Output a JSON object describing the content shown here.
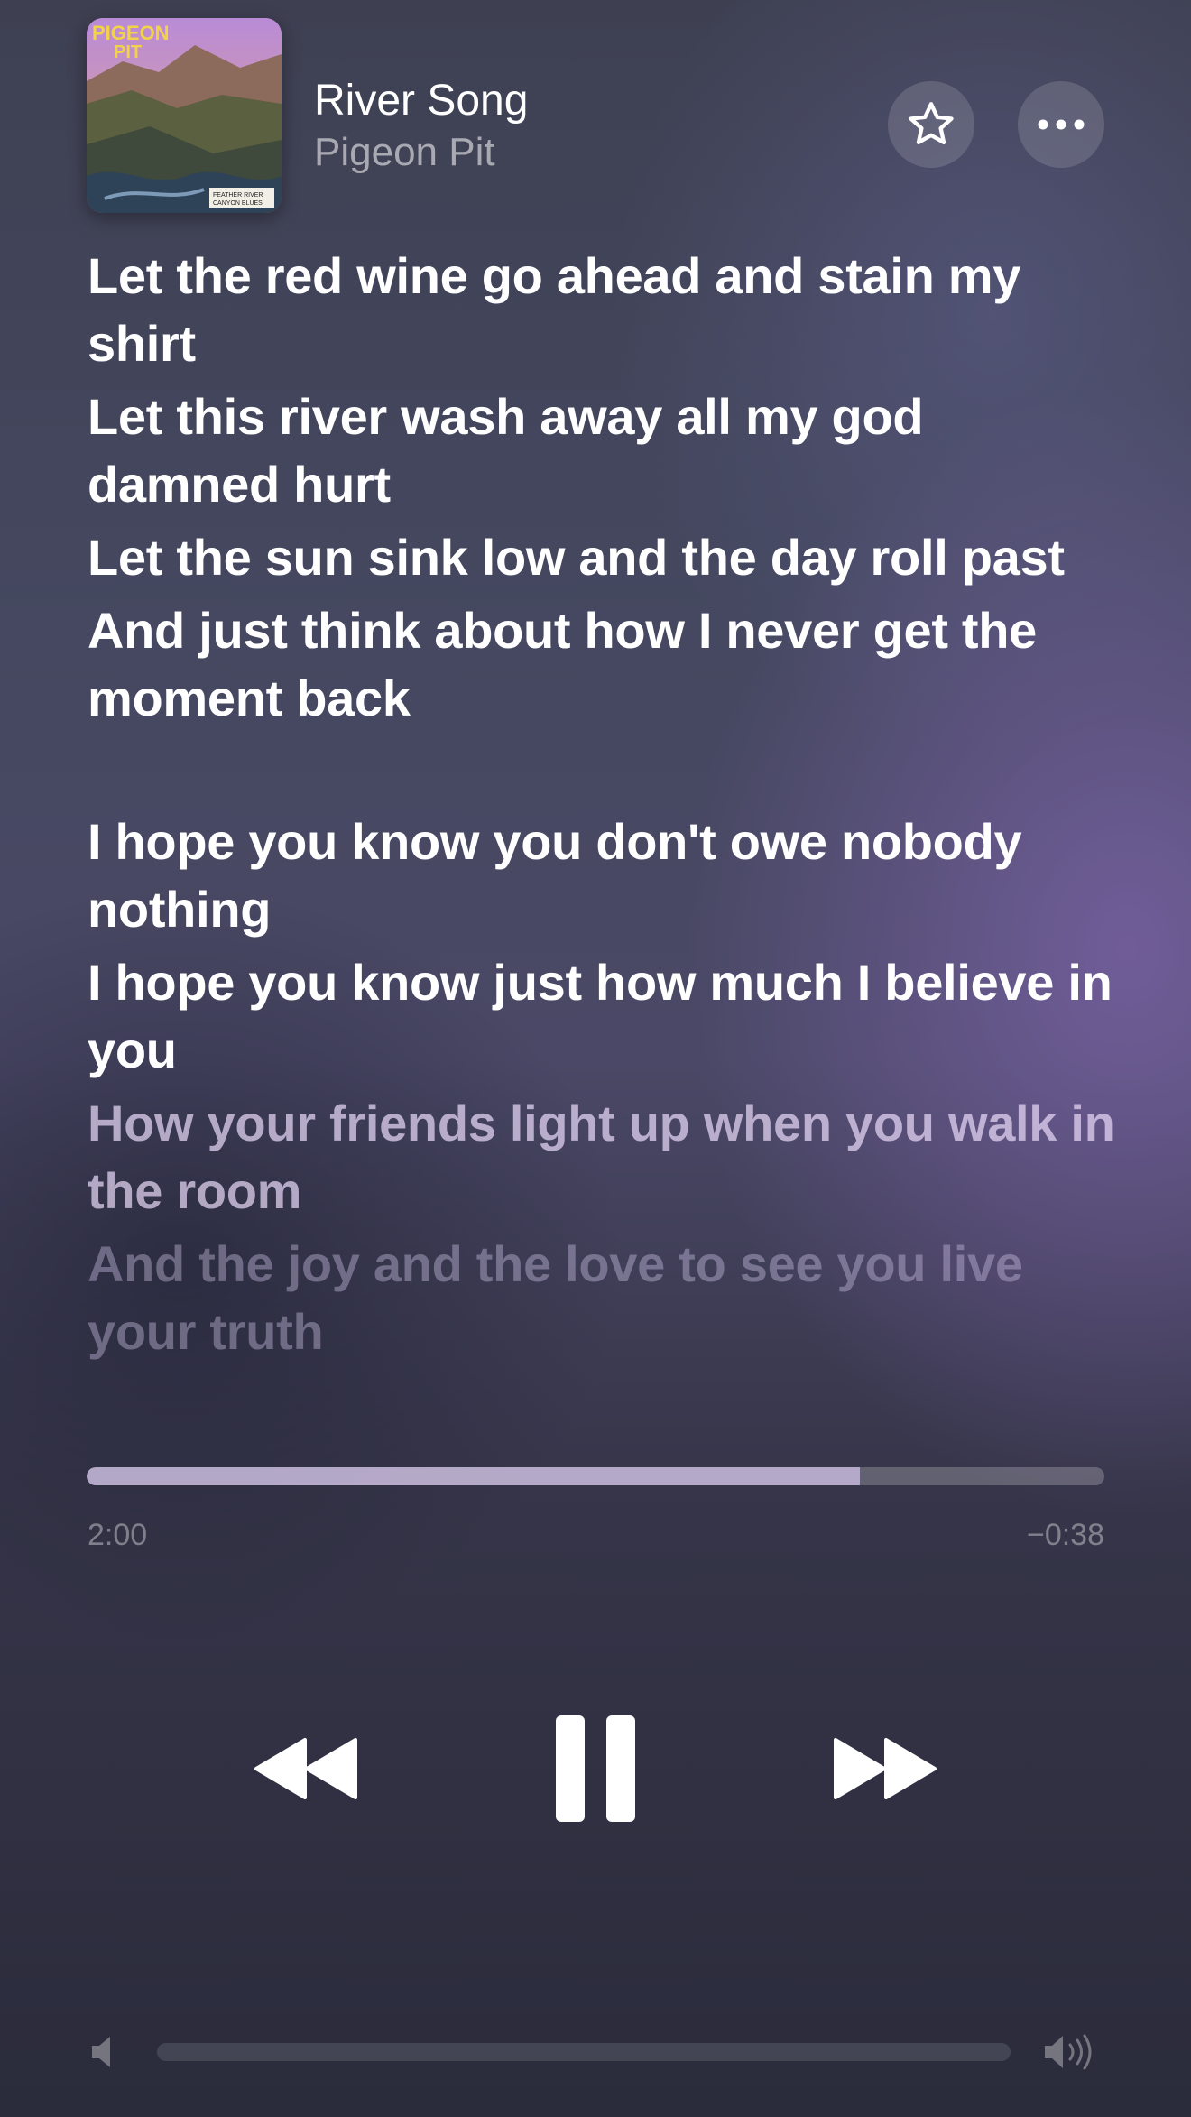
{
  "now_playing": {
    "title": "River Song",
    "artist": "Pigeon Pit",
    "artwork_icon": "album-artwork",
    "artwork_lettering": "PIGEON PIT — FEATHER RIVER CANYON BLUES"
  },
  "header_buttons": {
    "favorite_icon": "star-icon",
    "more_icon": "ellipsis-icon"
  },
  "lyrics": [
    {
      "text": "Let the red wine go ahead and stain my shirt",
      "state": "past"
    },
    {
      "text": "Let this river wash away all my god damned hurt",
      "state": "past"
    },
    {
      "text": "Let the sun sink low and the day roll past",
      "state": "past"
    },
    {
      "text": "And just think about how I never get the moment back",
      "state": "past"
    },
    {
      "text": "I hope you know you don't owe nobody nothing",
      "state": "past"
    },
    {
      "text": "I hope you know just how much I believe in you",
      "state": "current"
    },
    {
      "text": "How your friends light up when you walk in the room",
      "state": "upcoming"
    },
    {
      "text": "And the joy and the love to see you live your truth",
      "state": "upcoming"
    }
  ],
  "playback": {
    "elapsed": "2:00",
    "remaining": "−0:38",
    "progress_fraction": 0.76,
    "state": "playing"
  },
  "controls": {
    "rewind_icon": "rewind-icon",
    "pause_icon": "pause-icon",
    "forward_icon": "fast-forward-icon"
  },
  "volume": {
    "level_fraction": 0.0,
    "low_icon": "speaker-low-icon",
    "high_icon": "speaker-high-icon"
  },
  "colors": {
    "text_primary": "#ffffff",
    "text_secondary": "#9a9cae",
    "progress_fill": "#cdbee1"
  }
}
